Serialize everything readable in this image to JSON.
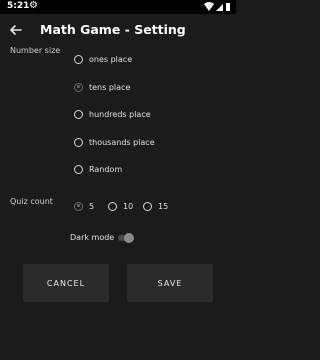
{
  "status_bar": {
    "time": "5:21"
  },
  "app_bar": {
    "title": "Math Game - Setting"
  },
  "number_size": {
    "label": "Number size",
    "options": [
      {
        "label": "ones place",
        "checked": false
      },
      {
        "label": "tens place",
        "checked": true
      },
      {
        "label": "hundreds place",
        "checked": false
      },
      {
        "label": "thousands place",
        "checked": false
      },
      {
        "label": "Random",
        "checked": false
      }
    ]
  },
  "quiz_count": {
    "label": "Quiz count",
    "options": [
      {
        "label": "5",
        "checked": true
      },
      {
        "label": "10",
        "checked": false
      },
      {
        "label": "15",
        "checked": false
      }
    ]
  },
  "dark_mode": {
    "label": "Dark mode",
    "enabled": true
  },
  "buttons": {
    "cancel": "CANCEL",
    "save": "SAVE"
  },
  "colors": {
    "background": "#1b1b1b",
    "button": "#2b2b2b",
    "text": "#e6e6e6",
    "radio_checked": "#6b6b6b"
  }
}
